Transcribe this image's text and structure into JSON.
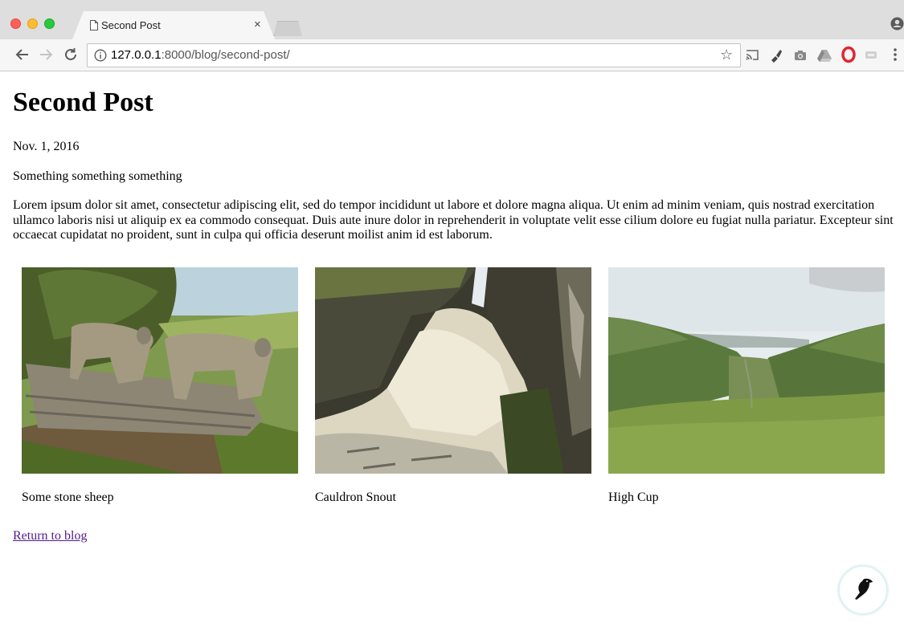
{
  "browser": {
    "tab_title": "Second Post",
    "tab_close": "×",
    "url_host": "127.0.0.1",
    "url_rest": ":8000/blog/second-post/"
  },
  "post": {
    "title": "Second Post",
    "date": "Nov. 1, 2016",
    "intro": "Something something something",
    "body": "Lorem ipsum dolor sit amet, consectetur adipiscing elit, sed do tempor incididunt ut labore et dolore magna aliqua. Ut enim ad minim veniam, quis nostrad exercitation ullamco laboris nisi ut aliquip ex ea commodo consequat. Duis aute inure dolor in reprehenderit in voluptate velit esse cilium dolore eu fugiat nulla pariatur. Excepteur sint occaecat cupidatat no proident, sunt in culpa qui officia deserunt moilist anim id est laborum.",
    "gallery": [
      {
        "caption": "Some stone sheep"
      },
      {
        "caption": "Cauldron Snout"
      },
      {
        "caption": "High Cup"
      }
    ],
    "return_link": "Return to blog"
  },
  "icons": {
    "back": "arrow-left-icon",
    "forward": "arrow-right-icon",
    "reload": "reload-icon",
    "info": "info-icon",
    "bookmark": "star-icon",
    "wagtail": "wagtail-bird-icon"
  },
  "colors": {
    "link_visited": "#551a8b",
    "opera_red": "#e1262f"
  }
}
